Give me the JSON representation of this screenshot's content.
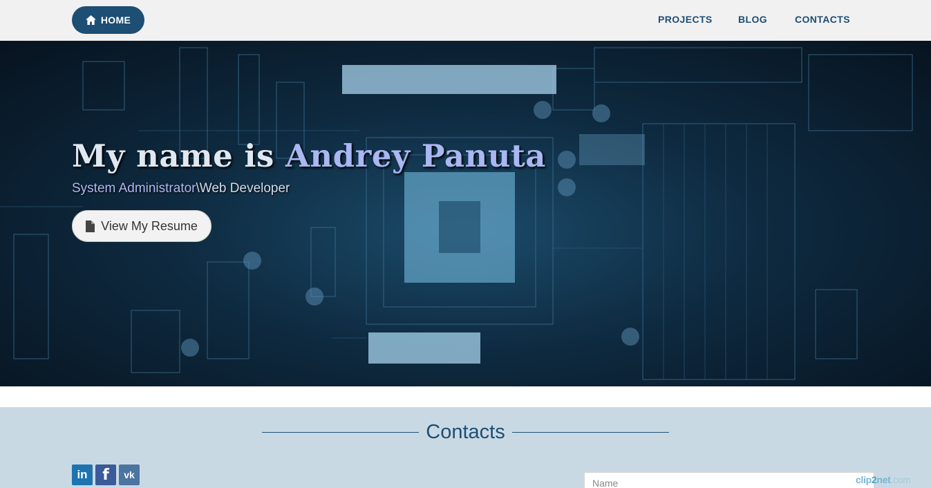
{
  "nav": {
    "home_label": "HOME",
    "links": [
      "PROJECTS",
      "BLOG",
      "CONTACTS"
    ]
  },
  "hero": {
    "title_prefix": "My name is ",
    "title_name": "Andrey Panuta",
    "subtitle_role1": "System Administrator",
    "subtitle_role2": "\\Web Developer",
    "resume_label": "View My Resume"
  },
  "contacts": {
    "heading": "Contacts",
    "social": [
      "in",
      "f",
      "vk"
    ],
    "name_placeholder": "Name"
  },
  "watermark": {
    "part1": "clip",
    "part2": "2",
    "part3": "net",
    "part4": ".com"
  },
  "colors": {
    "nav_bg": "#f1f1f1",
    "brand": "#1d4e74",
    "accent": "#a9b7f2",
    "contacts_bg": "#c9d9e4"
  },
  "icons": {
    "home": "home-icon",
    "resume": "file-icon",
    "linkedin": "linkedin-icon",
    "facebook": "facebook-icon",
    "vk": "vk-icon"
  }
}
